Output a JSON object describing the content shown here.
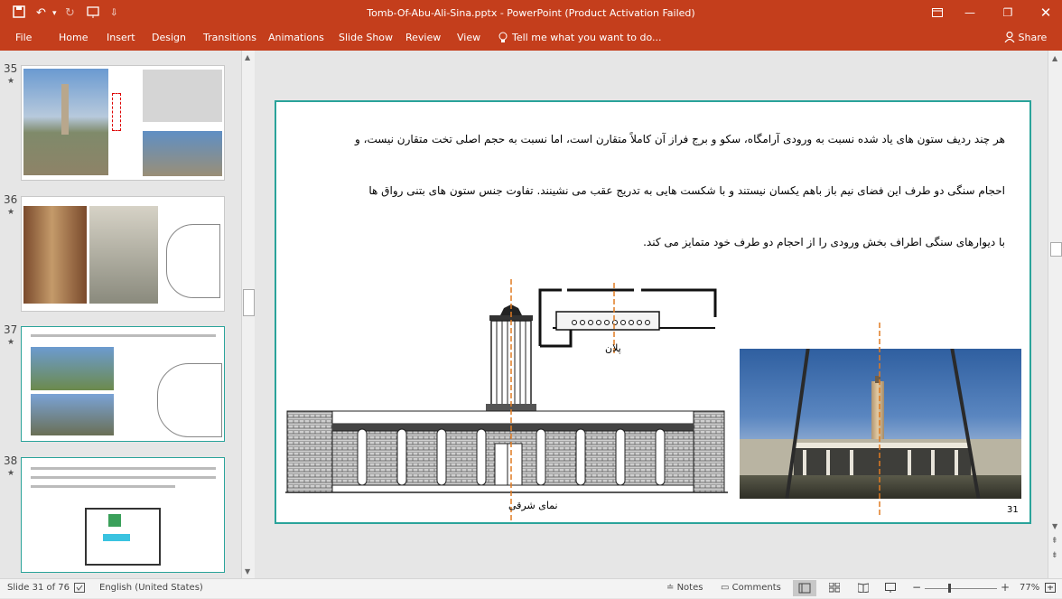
{
  "window": {
    "title": "Tomb-Of-Abu-Ali-Sina.pptx - PowerPoint (Product Activation Failed)",
    "share_label": "Share"
  },
  "ribbon": {
    "tabs": [
      "File",
      "Home",
      "Insert",
      "Design",
      "Transitions",
      "Animations",
      "Slide Show",
      "Review",
      "View"
    ],
    "tell_me": "Tell me what you want to do..."
  },
  "thumbnails": [
    {
      "number": "35",
      "star": "★"
    },
    {
      "number": "36",
      "star": "★"
    },
    {
      "number": "37",
      "star": "★"
    },
    {
      "number": "38",
      "star": "★"
    }
  ],
  "slide": {
    "paragraph_lines": [
      "هر چند ردیف ستون های یاد شده نسبت به ورودی آرامگاه، سکو و برج فراز آن کاملاً متقارن است، اما نسبت به حجم اصلی تخت متقارن نیست، و",
      "احجام سنگی دو طرف این فضای نیم باز باهم یکسان نیستند و با شکست هایی به تدریج عقب می نشینند. تفاوت جنس ستون های بتنی رواق ها",
      "با دیوارهای سنگی اطراف بخش ورودی را از احجام دو طرف خود متمایز می کند."
    ],
    "plan_label": "پلان",
    "elevation_label": "نمای شرقی",
    "page_number": "31"
  },
  "status": {
    "slide_info": "Slide 31 of 76",
    "language": "English (United States)",
    "notes": "Notes",
    "comments": "Comments",
    "zoom": "77%"
  },
  "colors": {
    "accent": "#c43e1c",
    "slide_border": "#2aa39a",
    "guide_line": "#e07b22"
  }
}
